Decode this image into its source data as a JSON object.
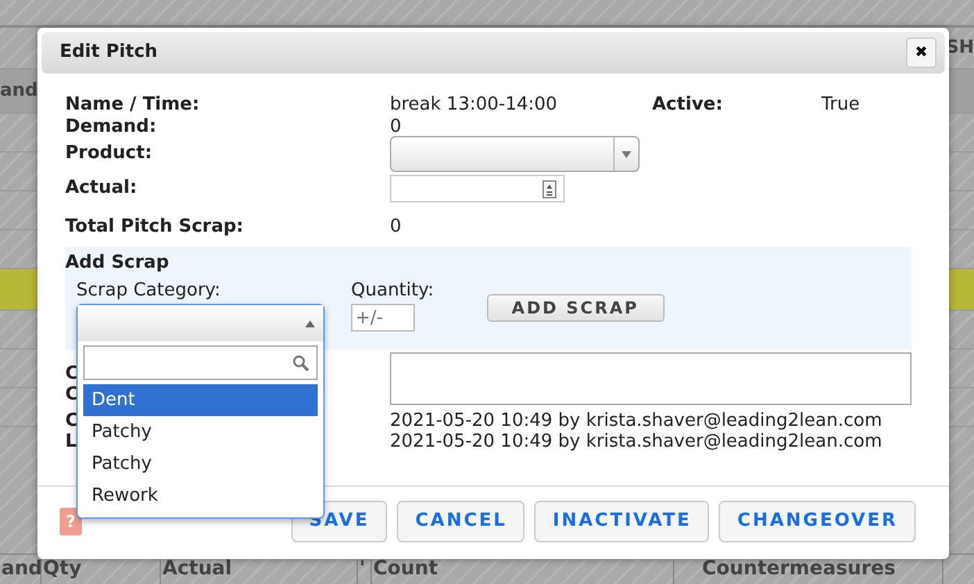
{
  "background": {
    "left_fragments": [
      "and"
    ],
    "right_fragments": [
      "SH"
    ],
    "bottom_headers": [
      "and",
      "Qty",
      "Actual",
      "'",
      "Count",
      "Countermeasures"
    ]
  },
  "dialog": {
    "title": "Edit Pitch",
    "close": "✖",
    "info": [
      {
        "label": "Name / Time:",
        "value": "break 13:00-14:00",
        "label2": "Active:",
        "value2": "True"
      },
      {
        "label": "Demand:",
        "value": "0"
      }
    ],
    "product": {
      "label": "Product:"
    },
    "actual": {
      "label": "Actual:"
    },
    "total_scrap": {
      "label": "Total Pitch Scrap:",
      "value": "0"
    },
    "add_scrap": {
      "title": "Add Scrap",
      "category_label": "Scrap Category:",
      "quantity_label": "Quantity:",
      "quantity_placeholder": "+/-",
      "button": "ADD SCRAP",
      "dropdown": {
        "expanded": true,
        "options": [
          {
            "label": "Dent",
            "selected": true
          },
          {
            "label": "Patchy",
            "selected": false
          },
          {
            "label": "Patchy",
            "selected": false
          },
          {
            "label": "Rework",
            "selected": false
          }
        ]
      }
    },
    "hidden_labels": [
      "C",
      "C",
      "C",
      "L"
    ],
    "timestamps": [
      "2021-05-20 10:49 by krista.shaver@leading2lean.com",
      "2021-05-20 10:49 by krista.shaver@leading2lean.com"
    ],
    "help": "?",
    "buttons": [
      "SAVE",
      "CANCEL",
      "INACTIVATE",
      "CHANGEOVER"
    ]
  }
}
